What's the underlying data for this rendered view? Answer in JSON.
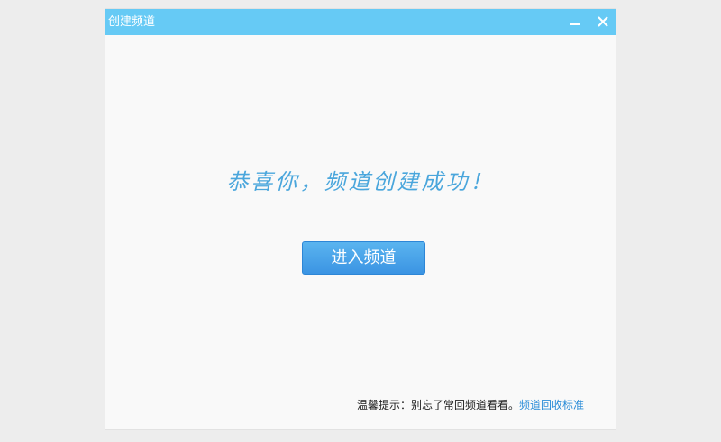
{
  "window": {
    "title": "创建频道",
    "colors": {
      "titlebar": "#66caf5",
      "body": "#f9f9f9"
    }
  },
  "controls": {
    "minimize_icon": "minimize-icon",
    "close_icon": "close-icon"
  },
  "main": {
    "success_message": "恭喜你，频道创建成功！",
    "enter_button_label": "进入频道",
    "accent_color": "#4aa6dc"
  },
  "footer": {
    "tip_text": "温馨提示：别忘了常回频道看看。",
    "tip_link": "频道回收标准",
    "link_color": "#2d8ed8"
  }
}
